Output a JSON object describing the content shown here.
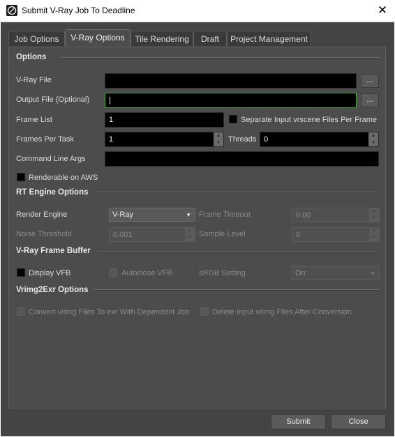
{
  "window": {
    "title": "Submit V-Ray Job To Deadline",
    "close_glyph": "✕"
  },
  "tabs": [
    {
      "label": "Job Options"
    },
    {
      "label": "V-Ray Options"
    },
    {
      "label": "Tile Rendering"
    },
    {
      "label": "Draft"
    },
    {
      "label": "Project Management"
    }
  ],
  "options": {
    "heading": "Options",
    "vray_file": {
      "label": "V-Ray File",
      "value": "",
      "browse": "..."
    },
    "output_file": {
      "label": "Output File (Optional)",
      "value": "|",
      "browse": "..."
    },
    "frame_list": {
      "label": "Frame List",
      "value": "1"
    },
    "separate_input": {
      "label": "Separate Input vrscene Files Per Frame"
    },
    "frames_per_task": {
      "label": "Frames Per Task",
      "value": "1"
    },
    "threads": {
      "label": "Threads",
      "value": "0"
    },
    "cmd_args": {
      "label": "Command Line Args",
      "value": ""
    },
    "aws": {
      "label": "Renderable on AWS"
    }
  },
  "rt": {
    "heading": "RT Engine Options",
    "render_engine": {
      "label": "Render Engine",
      "value": "V-Ray"
    },
    "frame_timeout": {
      "label": "Frame Timeout",
      "value": "0.00"
    },
    "noise_threshold": {
      "label": "Noise Threshold",
      "value": "0.001"
    },
    "sample_level": {
      "label": "Sample Level",
      "value": "0"
    }
  },
  "vfb": {
    "heading": "V-Ray Frame Buffer",
    "display_vfb": {
      "label": "Display VFB"
    },
    "autoclose_vfb": {
      "label": "Autoclose VFB"
    },
    "srgb": {
      "label": "sRGB Setting",
      "value": "On"
    }
  },
  "vrimg": {
    "heading": "Vrimg2Exr Options",
    "convert": {
      "label": "Convert vrimg Files To exr With Dependent Job"
    },
    "delete": {
      "label": "Delete Input vrimg Files After Conversion"
    }
  },
  "buttons": {
    "submit": "Submit",
    "close": "Close"
  }
}
